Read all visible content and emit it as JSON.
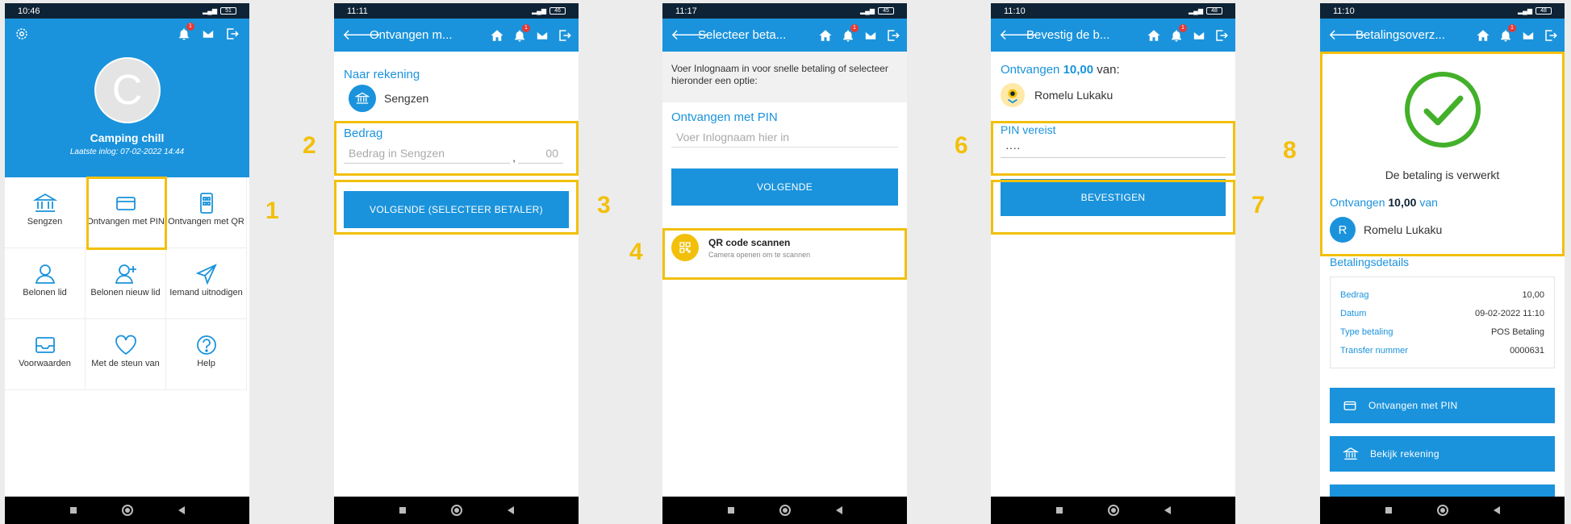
{
  "colors": {
    "primary": "#1a93dc",
    "highlight": "#f2c00b",
    "success": "#43b02a"
  },
  "steps": [
    "1",
    "2",
    "3",
    "4",
    "6",
    "7",
    "8"
  ],
  "screen1": {
    "time": "10:46",
    "battery": "51",
    "account_name": "Camping chill",
    "last_login": "Laatste inlog: 07-02-2022 14:44",
    "avatar_letter": "C",
    "grid": [
      {
        "label": "Sengzen",
        "icon": "bank-icon"
      },
      {
        "label": "Ontvangen met PIN",
        "icon": "card-icon"
      },
      {
        "label": "Ontvangen met QR",
        "icon": "qr-phone-icon"
      },
      {
        "label": "Belonen lid",
        "icon": "user-icon"
      },
      {
        "label": "Belonen nieuw lid",
        "icon": "user-add-icon"
      },
      {
        "label": "Iemand uitnodigen",
        "icon": "send-icon"
      },
      {
        "label": "Voorwaarden",
        "icon": "inbox-icon"
      },
      {
        "label": "Met de steun van",
        "icon": "heart-icon"
      },
      {
        "label": "Help",
        "icon": "help-icon"
      }
    ]
  },
  "screen2": {
    "time": "11:11",
    "battery": "46",
    "title": "Ontvangen m...",
    "to_account_label": "Naar rekening",
    "account": "Sengzen",
    "amount_label": "Bedrag",
    "amount_placeholder": "Bedrag in Sengzen",
    "decimal_separator": ",",
    "cents_placeholder": "00",
    "next_button": "VOLGENDE (SELECTEER BETALER)"
  },
  "screen3": {
    "time": "11:17",
    "battery": "45",
    "title": "Selecteer beta...",
    "info": "Voer Inlognaam in voor snelle betaling of selecteer hieronder een optie:",
    "pin_label": "Ontvangen met PIN",
    "username_placeholder": "Voer Inlognaam hier in",
    "next_button": "VOLGENDE",
    "qr_title": "QR code scannen",
    "qr_subtitle": "Camera openen om te scannen"
  },
  "screen4": {
    "time": "11:10",
    "battery": "48",
    "title": "Bevestig de b...",
    "received_prefix": "Ontvangen",
    "amount": "10,00",
    "received_suffix": "van:",
    "payer": "Romelu Lukaku",
    "pin_label": "PIN vereist",
    "pin_value": "····",
    "confirm_button": "BEVESTIGEN"
  },
  "screen5": {
    "time": "11:10",
    "battery": "48",
    "title": "Betalingsoverz...",
    "processed": "De betaling is verwerkt",
    "received_prefix": "Ontvangen",
    "amount": "10,00",
    "received_suffix": "van",
    "payer_initial": "R",
    "payer": "Romelu Lukaku",
    "details_title": "Betalingsdetails",
    "details": [
      {
        "key": "Bedrag",
        "value": "10,00"
      },
      {
        "key": "Datum",
        "value": "09-02-2022 11:10"
      },
      {
        "key": "Type betaling",
        "value": "POS Betaling"
      },
      {
        "key": "Transfer nummer",
        "value": "0000631"
      }
    ],
    "btn_pin": "Ontvangen met PIN",
    "btn_account": "Bekijk rekening"
  }
}
